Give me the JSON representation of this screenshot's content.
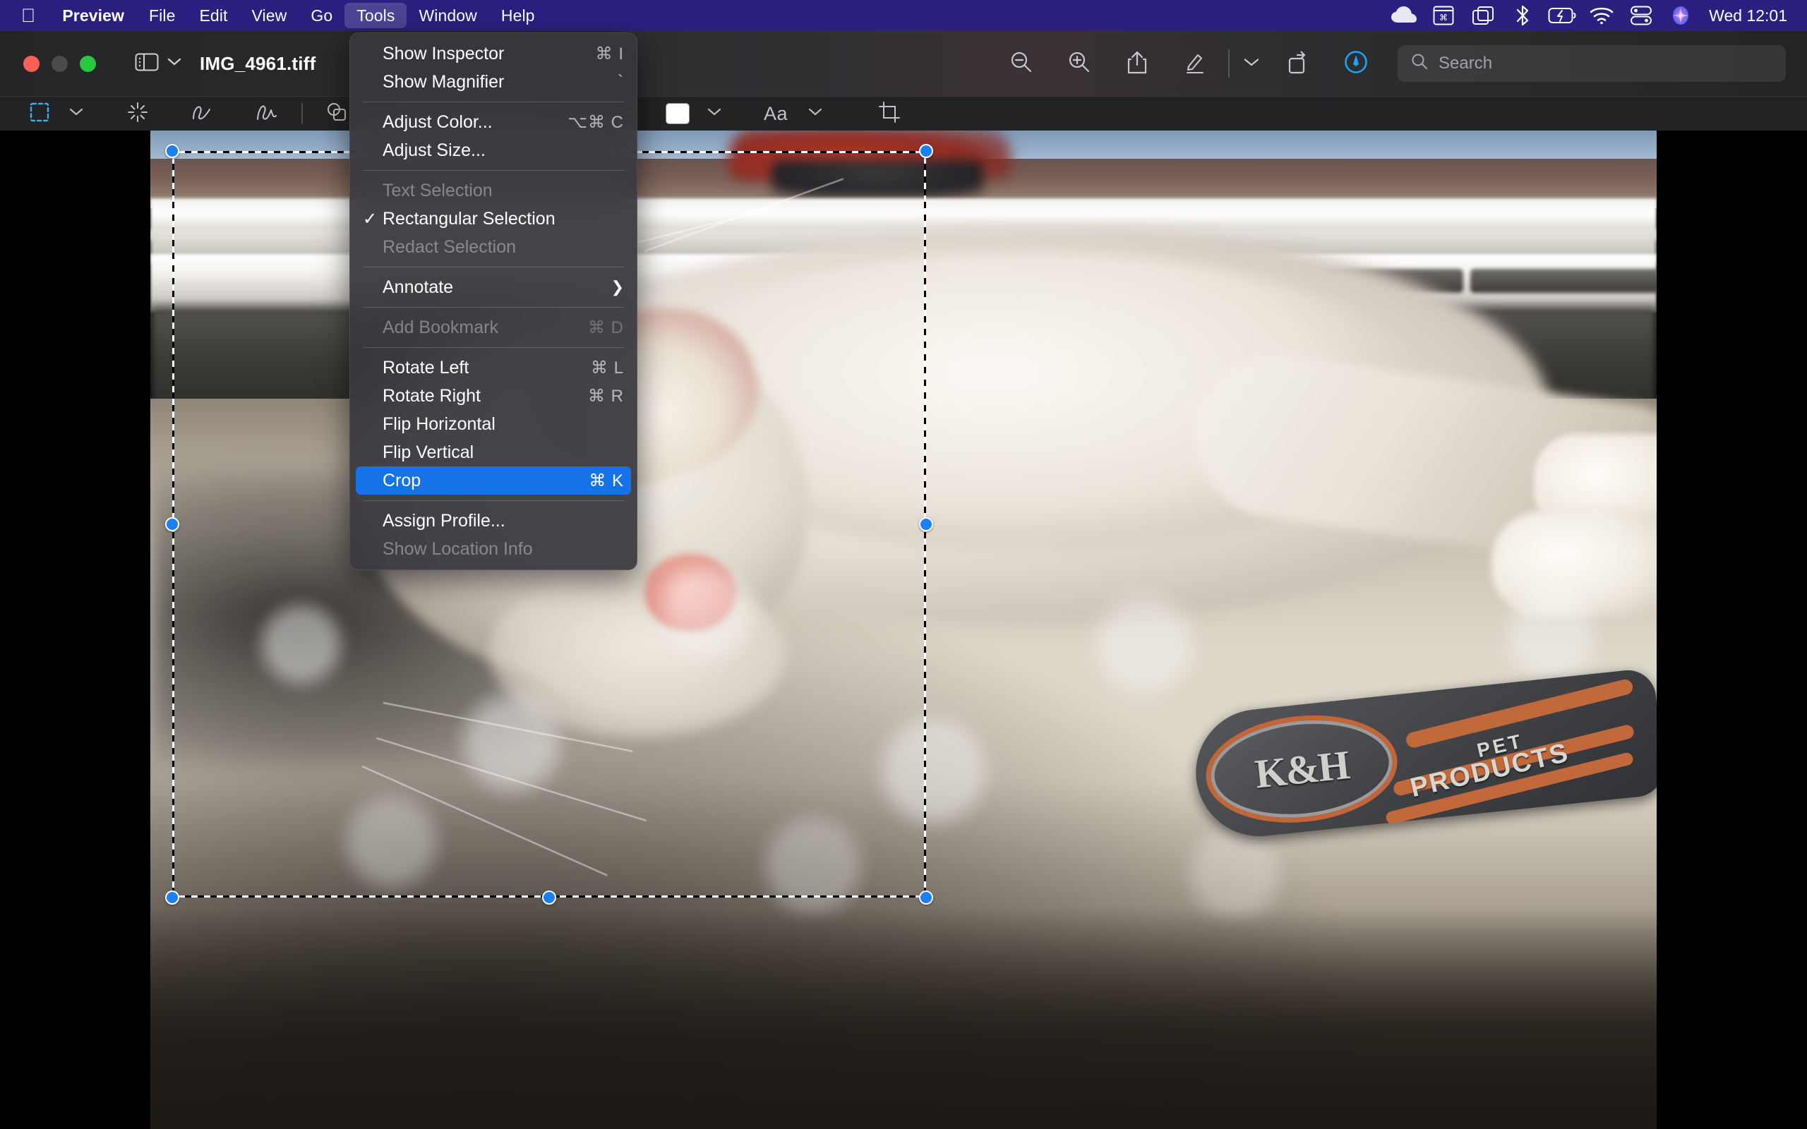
{
  "menubar": {
    "apple_icon": "apple-logo-icon",
    "items": [
      {
        "label": "Preview",
        "active": false,
        "bold": true
      },
      {
        "label": "File",
        "active": false,
        "bold": false
      },
      {
        "label": "Edit",
        "active": false,
        "bold": false
      },
      {
        "label": "View",
        "active": false,
        "bold": false
      },
      {
        "label": "Go",
        "active": false,
        "bold": false
      },
      {
        "label": "Tools",
        "active": true,
        "bold": false
      },
      {
        "label": "Window",
        "active": false,
        "bold": false
      },
      {
        "label": "Help",
        "active": false,
        "bold": false
      }
    ],
    "status_icons": [
      "cloud-icon",
      "keyboard-input-icon",
      "stage-manager-icon",
      "bluetooth-icon",
      "battery-charging-icon",
      "wifi-icon",
      "control-center-icon",
      "siri-icon"
    ],
    "clock": "Wed 12:01",
    "accent_color": "#2b2080"
  },
  "window": {
    "traffic_lights": [
      "close-button",
      "minimize-button",
      "maximize-button"
    ],
    "sidebar_toggle": "sidebar-toggle-icon",
    "document_title": "IMG_4961.tiff",
    "toolbar_right": [
      "zoom-out-icon",
      "zoom-in-icon",
      "share-icon",
      "markup-icon",
      "markup-chevron-icon",
      "rotate-icon",
      "annotate-icon"
    ],
    "search": {
      "placeholder": "Search",
      "icon": "search-icon"
    }
  },
  "markup_toolbar": {
    "items": [
      {
        "name": "selection-tool",
        "icon": "rectangular-selection-icon",
        "has_chevron": true,
        "selected": true
      },
      {
        "name": "instant-alpha-tool",
        "icon": "instant-alpha-icon",
        "has_chevron": false,
        "selected": false
      },
      {
        "name": "sketch-tool",
        "icon": "sketch-icon",
        "has_chevron": false,
        "selected": false
      },
      {
        "name": "draw-tool",
        "icon": "draw-icon",
        "has_chevron": false,
        "selected": false
      },
      {
        "name": "shapes-tool",
        "icon": "shapes-icon",
        "has_chevron": true,
        "selected": false
      },
      {
        "name": "text-tool",
        "icon": "text-box-icon",
        "has_chevron": false,
        "selected": false
      },
      {
        "name": "shape-style-tool",
        "icon": "shape-style-icon",
        "has_chevron": true,
        "selected": false
      },
      {
        "name": "border-color-tool",
        "icon": "border-color-icon",
        "has_chevron": true,
        "selected": false
      },
      {
        "name": "fill-color-tool",
        "icon": "fill-color-swatch",
        "has_chevron": true,
        "selected": false
      },
      {
        "name": "text-style-tool",
        "icon": "text-style-icon",
        "label": "Aa",
        "has_chevron": true,
        "selected": false
      },
      {
        "name": "crop-tool",
        "icon": "crop-icon",
        "has_chevron": false,
        "selected": false
      }
    ],
    "fill_color": "#ffffff",
    "selection_accent": "#3bb0f0",
    "text_style_label": "Aa"
  },
  "tools_menu": {
    "highlight_color": "#1473e6",
    "items": [
      {
        "type": "item",
        "label": "Show Inspector",
        "shortcut": "⌘ I",
        "enabled": true,
        "checked": false,
        "highlighted": false
      },
      {
        "type": "item",
        "label": "Show Magnifier",
        "shortcut": "`",
        "enabled": true,
        "checked": false,
        "highlighted": false
      },
      {
        "type": "separator"
      },
      {
        "type": "item",
        "label": "Adjust Color...",
        "shortcut": "⌥⌘ C",
        "enabled": true,
        "checked": false,
        "highlighted": false
      },
      {
        "type": "item",
        "label": "Adjust Size...",
        "shortcut": "",
        "enabled": true,
        "checked": false,
        "highlighted": false
      },
      {
        "type": "separator"
      },
      {
        "type": "item",
        "label": "Text Selection",
        "shortcut": "",
        "enabled": false,
        "checked": false,
        "highlighted": false
      },
      {
        "type": "item",
        "label": "Rectangular Selection",
        "shortcut": "",
        "enabled": true,
        "checked": true,
        "highlighted": false
      },
      {
        "type": "item",
        "label": "Redact Selection",
        "shortcut": "",
        "enabled": false,
        "checked": false,
        "highlighted": false
      },
      {
        "type": "separator"
      },
      {
        "type": "submenu",
        "label": "Annotate",
        "shortcut": "",
        "enabled": true,
        "checked": false,
        "highlighted": false
      },
      {
        "type": "separator"
      },
      {
        "type": "item",
        "label": "Add Bookmark",
        "shortcut": "⌘ D",
        "enabled": false,
        "checked": false,
        "highlighted": false
      },
      {
        "type": "separator"
      },
      {
        "type": "item",
        "label": "Rotate Left",
        "shortcut": "⌘ L",
        "enabled": true,
        "checked": false,
        "highlighted": false
      },
      {
        "type": "item",
        "label": "Rotate Right",
        "shortcut": "⌘ R",
        "enabled": true,
        "checked": false,
        "highlighted": false
      },
      {
        "type": "item",
        "label": "Flip Horizontal",
        "shortcut": "",
        "enabled": true,
        "checked": false,
        "highlighted": false
      },
      {
        "type": "item",
        "label": "Flip Vertical",
        "shortcut": "",
        "enabled": true,
        "checked": false,
        "highlighted": false
      },
      {
        "type": "item",
        "label": "Crop",
        "shortcut": "⌘ K",
        "enabled": true,
        "checked": false,
        "highlighted": true
      },
      {
        "type": "separator"
      },
      {
        "type": "item",
        "label": "Assign Profile...",
        "shortcut": "",
        "enabled": true,
        "checked": false,
        "highlighted": false
      },
      {
        "type": "item",
        "label": "Show Location Info",
        "shortcut": "",
        "enabled": false,
        "checked": false,
        "highlighted": false
      }
    ]
  },
  "photo": {
    "description": "sleeping white kitten on a fluffy cream pet bed by a sunlit window",
    "badge": {
      "brand": "K&H",
      "line1": "PET",
      "line2": "PRODUCTS",
      "plate_color": "#3f4145",
      "accent_color": "#c2693c"
    }
  },
  "selection": {
    "handle_color": "#1c7ff2",
    "handle_border": "#ffffff",
    "handles": [
      "top-left",
      "top-right",
      "middle-left",
      "middle-right",
      "bottom-left",
      "bottom-middle",
      "bottom-right"
    ]
  }
}
